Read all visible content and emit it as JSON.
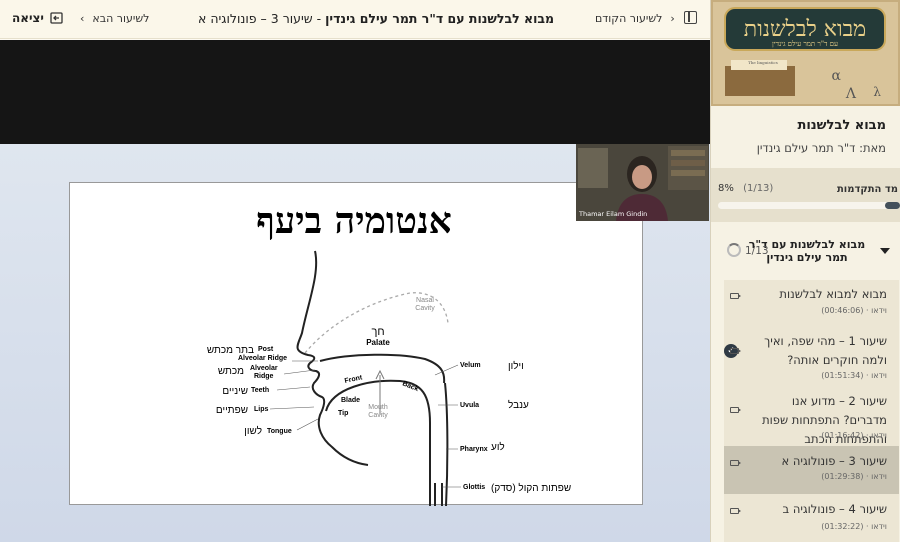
{
  "topbar": {
    "exit_label": "יציאה",
    "next_label": "לשיעור הבא",
    "title_course": "מבוא לבלשנות עם ד\"ר תמר עילם גינדין",
    "title_lesson": " - שיעור 3 – פונולוגיה א",
    "prev_label": "לשיעור הקודם"
  },
  "webcam": {
    "caption": "Thamar Eilam Gindin"
  },
  "slide": {
    "heading": "אנטומיה ביעף",
    "labels": {
      "nasal": "Nasal",
      "cavity": "Cavity",
      "palate_he": "חך",
      "palate": "Palate",
      "post": "Post",
      "alv_ridge": "Alveolar Ridge",
      "post_he": "בתר מכתש",
      "alveolar": "Alveolar",
      "ridge": "Ridge",
      "alveolar_he": "מכתש",
      "teeth": "Teeth",
      "teeth_he": "שיניים",
      "lips": "Lips",
      "lips_he": "שפתיים",
      "tongue": "Tongue",
      "tongue_he": "לשון",
      "front": "Front",
      "back": "Back",
      "blade": "Blade",
      "tip": "Tip",
      "mouth": "Mouth",
      "mouth_cavity": "Cavity",
      "velum": "Velum",
      "velum_he": "וילון",
      "uvula": "Uvula",
      "uvula_he": "ענבל",
      "pharynx": "Pharynx",
      "pharynx_he": "לוע",
      "glottis": "Glottis",
      "glottis_he": "שפתות הקול (סדק)"
    }
  },
  "sidebar": {
    "course_title": "מבוא לבלשנות",
    "author": "מאת: ד\"ר תמר עילם גינדין",
    "banner_title": "מבוא לבלשנות",
    "banner_sub": "עם ד\"ר תמר עילם גינדין",
    "banner_tagline": "The linguistics",
    "progress": {
      "label": "מד התקדמות",
      "percent": "8%",
      "count": "(1/13)",
      "fraction": 0.08
    },
    "section": {
      "name": "מבוא לבלשנות עם ד\"ר תמר עילם גינדין",
      "count": "1/13"
    },
    "lessons": [
      {
        "title": "מבוא למבוא לבלשנות",
        "type": "וידאו",
        "duration": "(00:46:06)",
        "done": false,
        "active": false
      },
      {
        "title": "שיעור 1 – מהי שפה, ואיך ולמה חוקרים אותה?",
        "type": "וידאו",
        "duration": "(01:51:34)",
        "done": true,
        "active": false
      },
      {
        "title": "שיעור 2 – מדוע אנו מדברים? התפתחות שפות והתפתחות הכתב",
        "type": "וידאו",
        "duration": "(01:16:42)",
        "done": false,
        "active": false
      },
      {
        "title": "שיעור 3 – פונולוגיה א",
        "type": "וידאו",
        "duration": "(01:29:38)",
        "done": false,
        "active": true
      },
      {
        "title": "שיעור 4 – פונולוגיה ב",
        "type": "וידאו",
        "duration": "(01:32:22)",
        "done": false,
        "active": false
      }
    ],
    "meta_sep": "·"
  }
}
